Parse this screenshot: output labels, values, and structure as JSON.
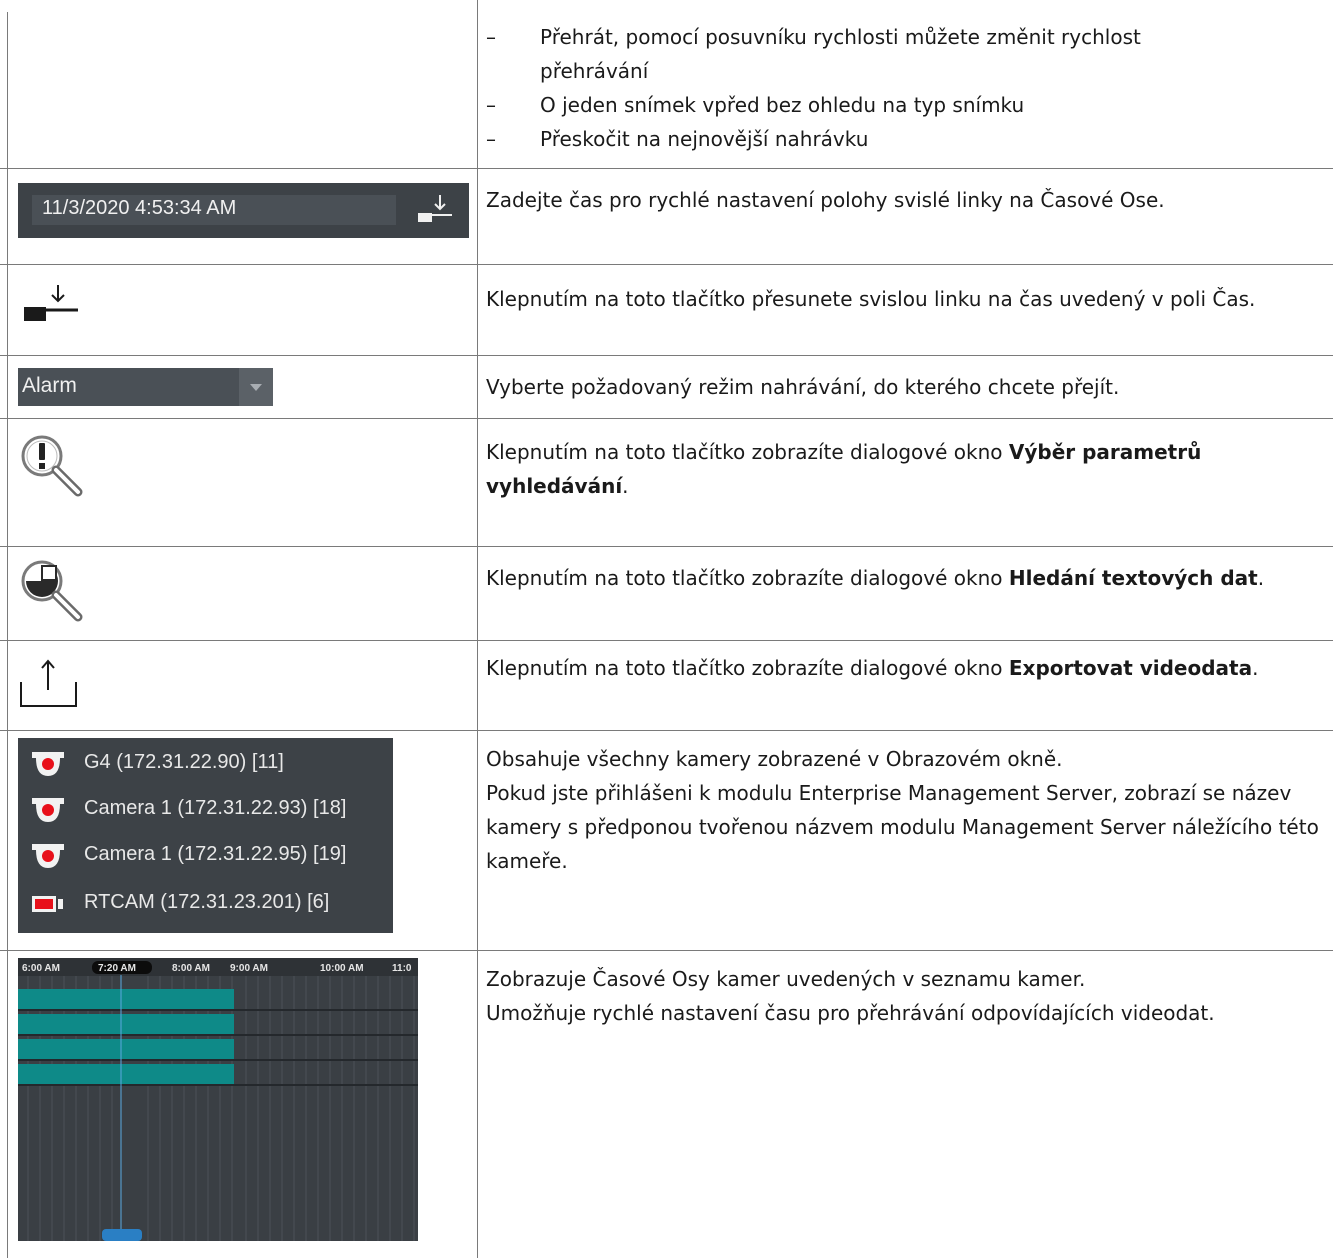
{
  "row1": {
    "bullets": [
      "Přehrát, pomocí posuvníku rychlosti můžete změnit rychlost přehrávání",
      "O jeden snímek vpřed bez ohledu na typ snímku",
      "Přeskočit na nejnovější nahrávku"
    ],
    "dash": "–"
  },
  "row2": {
    "time_value": "11/3/2020 4:53:34 AM",
    "description": "Zadejte čas pro rychlé nastavení polohy svislé linky na Časové Ose."
  },
  "row3": {
    "icon": "goto-time-icon",
    "description": "Klepnutím na toto tlačítko přesunete svislou linku na čas uvedený v poli Čas."
  },
  "row4": {
    "selected": "Alarm",
    "description": "Vyberte požadovaný režim nahrávání, do kterého chcete přejít."
  },
  "row5": {
    "icon": "alarm-search-icon",
    "description_prefix": "Klepnutím na toto tlačítko zobrazíte dialogové okno ",
    "description_bold": "Výběr parametrů vyhledávání",
    "description_suffix": "."
  },
  "row6": {
    "icon": "text-data-search-icon",
    "description_prefix": "Klepnutím na toto tlačítko zobrazíte dialogové okno ",
    "description_bold": "Hledání textových dat",
    "description_suffix": "."
  },
  "row7": {
    "icon": "export-icon",
    "description_prefix": "Klepnutím na toto tlačítko zobrazíte dialogové okno ",
    "description_bold": "Exportovat videodata",
    "description_suffix": "."
  },
  "row8": {
    "cameras": [
      {
        "label": "G4 (172.31.22.90) [11]",
        "icon": "dome-camera-icon"
      },
      {
        "label": "Camera 1 (172.31.22.93) [18]",
        "icon": "dome-camera-icon"
      },
      {
        "label": "Camera 1 (172.31.22.95) [19]",
        "icon": "dome-camera-icon"
      },
      {
        "label": "RTCAM (172.31.23.201) [6]",
        "icon": "box-camera-icon"
      }
    ],
    "description_line1": "Obsahuje všechny kamery zobrazené v Obrazovém okně.",
    "description_line2": "Pokud jste přihlášeni k modulu Enterprise Management Server, zobrazí se název kamery s předponou tvořenou názvem modulu Management Server náležícího této kameře."
  },
  "row9": {
    "time_labels": [
      "6:00 AM",
      "7:20 AM",
      "8:00 AM",
      "9:00 AM",
      "10:00 AM",
      "11:0"
    ],
    "description_line1": "Zobrazuje Časové Osy kamer uvedených v seznamu kamer.",
    "description_line2": "Umožňuje rychlé nastavení času pro přehrávání odpovídajících videodat."
  },
  "colors": {
    "panel_bg": "#3d4247",
    "recording_bar": "#0e8a88",
    "camera_red": "#e8101a",
    "cursor_line": "#5aa8e0"
  }
}
